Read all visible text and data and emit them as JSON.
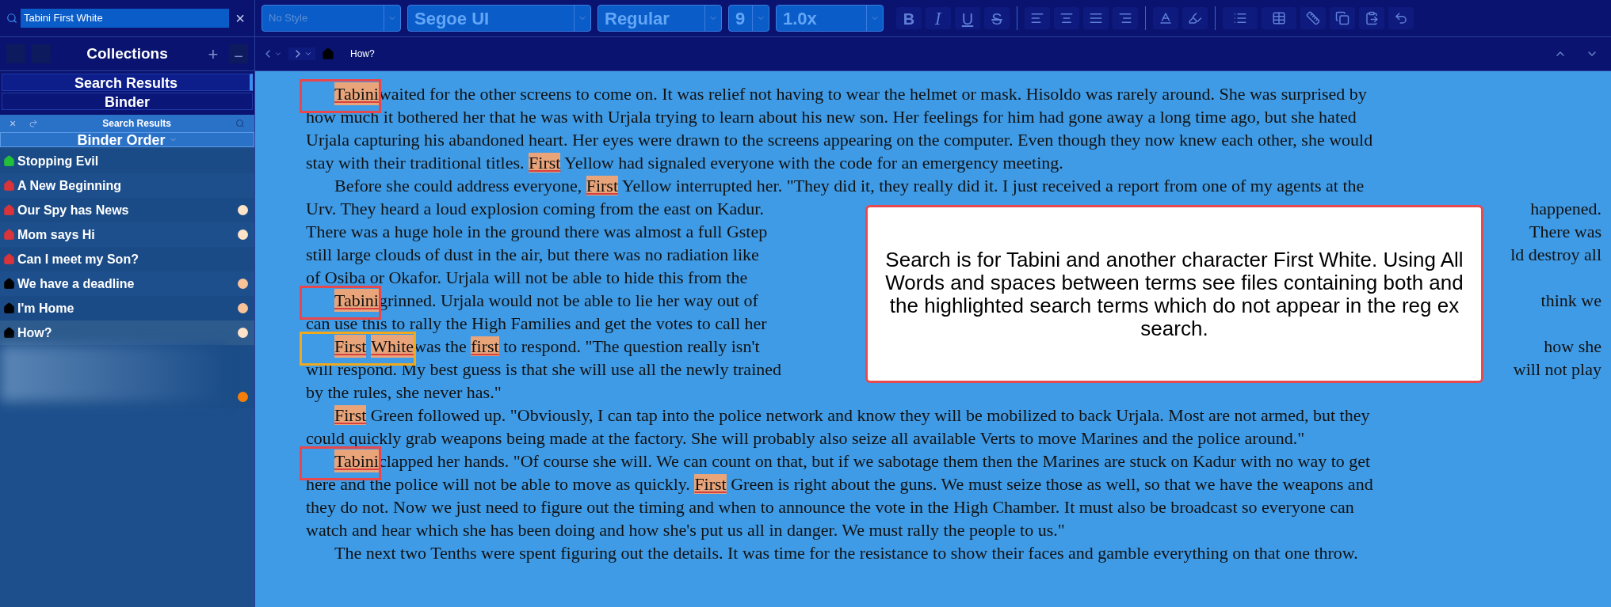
{
  "search": {
    "value": "Tabini First White",
    "clear": "×"
  },
  "toolbar": {
    "dropdowns": [
      {
        "placeholder": "No Style"
      },
      {
        "value": "Segoe UI"
      },
      {
        "value": "Regular"
      },
      {
        "value": "9"
      },
      {
        "value": "1.0x"
      }
    ],
    "format_buttons": [
      {
        "label": "B",
        "kind": "bold"
      },
      {
        "label": "I",
        "kind": "italic"
      },
      {
        "label": "U",
        "kind": "underline"
      },
      {
        "label": "S",
        "kind": "strike"
      }
    ]
  },
  "collections": {
    "title": "Collections",
    "add": "+",
    "remove": "−",
    "tabs": [
      {
        "label": "Search Results",
        "selected": true
      },
      {
        "label": "Binder",
        "selected": false
      }
    ]
  },
  "results_panel": {
    "close": "×",
    "title": "Search Results",
    "sort": "Binder Order",
    "items": [
      {
        "label": "Stopping Evil",
        "color": "#22c03a",
        "selected": false
      },
      {
        "label": "A New Beginning",
        "color": "#d9343a",
        "selected": false
      },
      {
        "label": "Our Spy has News",
        "color": "#d9343a",
        "dot": {
          "color": "#fde3c8"
        },
        "selected": false
      },
      {
        "label": "Mom says Hi",
        "color": "#d9343a",
        "dot": {
          "color": "#fde3c8"
        },
        "selected": false
      },
      {
        "label": "Can I meet my Son?",
        "color": "#d9343a",
        "selected": false
      },
      {
        "label": "We have a deadline",
        "color": "#000000",
        "dot": {
          "color": "#f9c39a"
        },
        "selected": false
      },
      {
        "label": "I'm Home",
        "color": "#000000",
        "dot": {
          "color": "#f9c39a"
        },
        "selected": false
      },
      {
        "label": "How?",
        "color": "#000000",
        "dot": {
          "color": "#fde3c8"
        },
        "selected": true
      }
    ],
    "blurred_row": {
      "dot": {
        "color": "#f57f0a"
      }
    }
  },
  "editor": {
    "breadcrumb": "How?",
    "lines": [
      {
        "indent": true,
        "frame": {
          "color": "#e8474c"
        },
        "segments": [
          {
            "text": "Tabini",
            "highlighted": true,
            "framed": true
          },
          {
            "text": " waited for the other screens to come on. It was relief not having to wear the helmet or mask. Hisoldo was rarely around. She was surprised by"
          }
        ]
      },
      {
        "segments": [
          {
            "text": "how much it bothered her that he was with Urjala trying to learn about his new son. Her feelings for him had gone away a long time ago, but she hated"
          }
        ]
      },
      {
        "segments": [
          {
            "text": "Urjala capturing his abandoned heart. Her eyes were drawn to the screens appearing on the computer. Even though they now knew each other, she would"
          }
        ]
      },
      {
        "segments": [
          {
            "text": "stay with their traditional titles. "
          },
          {
            "text": "First",
            "highlighted": true
          },
          {
            "text": " Yellow had signaled everyone with the code for an emergency meeting."
          }
        ]
      },
      {
        "indent": true,
        "segments": [
          {
            "text": "Before she could address everyone, "
          },
          {
            "text": "First",
            "highlighted": true
          },
          {
            "text": " Yellow interrupted her. \"They did it, they really did it. I just received a report from one of my agents at the"
          }
        ]
      },
      {
        "segments": [
          {
            "text": "Urv. They heard a loud explosion coming from the east on Kadur."
          }
        ],
        "right": "happened."
      },
      {
        "segments": [
          {
            "text": "There was a huge hole in the ground there was almost a full Gstep"
          }
        ],
        "right": "There was"
      },
      {
        "segments": [
          {
            "text": "still large clouds of dust in the air, but there was no radiation like"
          }
        ],
        "right": "ld destroy all"
      },
      {
        "segments": [
          {
            "text": "of Osiba or Okafor. Urjala will not be able to hide this from the"
          }
        ]
      },
      {
        "indent": true,
        "frame": {
          "color": "#e8474c"
        },
        "segments": [
          {
            "text": "Tabini",
            "highlighted": true,
            "framed": true
          },
          {
            "text": " grinned. Urjala would not be able to lie her way out of"
          }
        ],
        "right": "think we"
      },
      {
        "segments": [
          {
            "text": "can use this to rally the High Families and get the votes to call her"
          }
        ]
      },
      {
        "indent": true,
        "frame": {
          "color": "#f0a81c"
        },
        "segments": [
          {
            "text": "First",
            "highlighted": true,
            "framed": true
          },
          {
            "text": "White",
            "highlighted": true,
            "framed": true
          },
          {
            "text": " was the "
          },
          {
            "text": "first",
            "highlighted": true
          },
          {
            "text": " to respond. \"The question really isn't"
          }
        ],
        "right": "how she"
      },
      {
        "segments": [
          {
            "text": "will respond. My best guess is that she will use all the newly trained"
          }
        ],
        "right": "will not play"
      },
      {
        "segments": [
          {
            "text": "by the rules, she never has.\""
          }
        ]
      },
      {
        "indent": true,
        "segments": [
          {
            "text": "First",
            "highlighted": true
          },
          {
            "text": " Green followed up. \"Obviously, I can tap into the police network and know they will be mobilized to back Urjala. Most are not armed, but they"
          }
        ]
      },
      {
        "segments": [
          {
            "text": "could quickly grab weapons being made at the factory. She will probably also seize all available Verts to move Marines and the police around.\""
          }
        ]
      },
      {
        "indent": true,
        "frame": {
          "color": "#e8474c"
        },
        "segments": [
          {
            "text": "Tabini",
            "highlighted": true,
            "framed": true
          },
          {
            "text": " clapped her hands. \"Of course she will. We can count on that, but if we sabotage them then the Marines are stuck on Kadur with no way to get"
          }
        ]
      },
      {
        "segments": [
          {
            "text": "here and the police will not be able to move as quickly. "
          },
          {
            "text": "First",
            "highlighted": true
          },
          {
            "text": " Green is right about the guns. We must seize those as well, so that we have the weapons and"
          }
        ]
      },
      {
        "segments": [
          {
            "text": "they do not. Now we just need to figure out the timing and when to announce the vote in the High Chamber. It must also be broadcast so everyone can"
          }
        ]
      },
      {
        "segments": [
          {
            "text": "watch and hear which she has been doing and how she's put us all in danger. We must rally the people to us.\""
          }
        ]
      },
      {
        "indent": true,
        "segments": [
          {
            "text": "The next two Tenths were spent figuring out the details. It was time for the resistance to show their faces and gamble everything on that one throw."
          }
        ]
      }
    ],
    "callout": "Search is for Tabini and another character First White. Using All Words and spaces between terms see files containing both and the highlighted search terms which do not appear in the reg ex search."
  }
}
